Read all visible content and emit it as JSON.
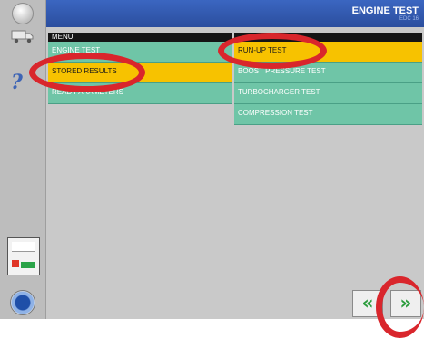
{
  "header": {
    "title": "ENGINE TEST",
    "subtitle": "EDC 16"
  },
  "menu": {
    "heading": "MENU",
    "items": [
      {
        "label": "ENGINE TEST",
        "selected": false
      },
      {
        "label": "STORED RESULTS",
        "selected": true
      },
      {
        "label": "READ PARAMETERS",
        "selected": false
      }
    ]
  },
  "submenu": {
    "items": [
      {
        "label": "RUN-UP TEST",
        "selected": true
      },
      {
        "label": "BOOST PRESSURE TEST",
        "selected": false
      },
      {
        "label": "TURBOCHARGER TEST",
        "selected": false
      },
      {
        "label": "COMPRESSION TEST",
        "selected": false
      }
    ]
  },
  "nav": {
    "back_glyph": "«",
    "forward_glyph": "»"
  },
  "sidebar": {
    "help_glyph": "?"
  },
  "colors": {
    "header": "#2f58ad",
    "row": "#6fc5a7",
    "selected": "#f7c200",
    "annotation": "#d9262c",
    "arrow": "#2a9c3c"
  },
  "icons": [
    "power-icon",
    "truck-icon",
    "help-icon",
    "device-icon",
    "disc-icon"
  ]
}
